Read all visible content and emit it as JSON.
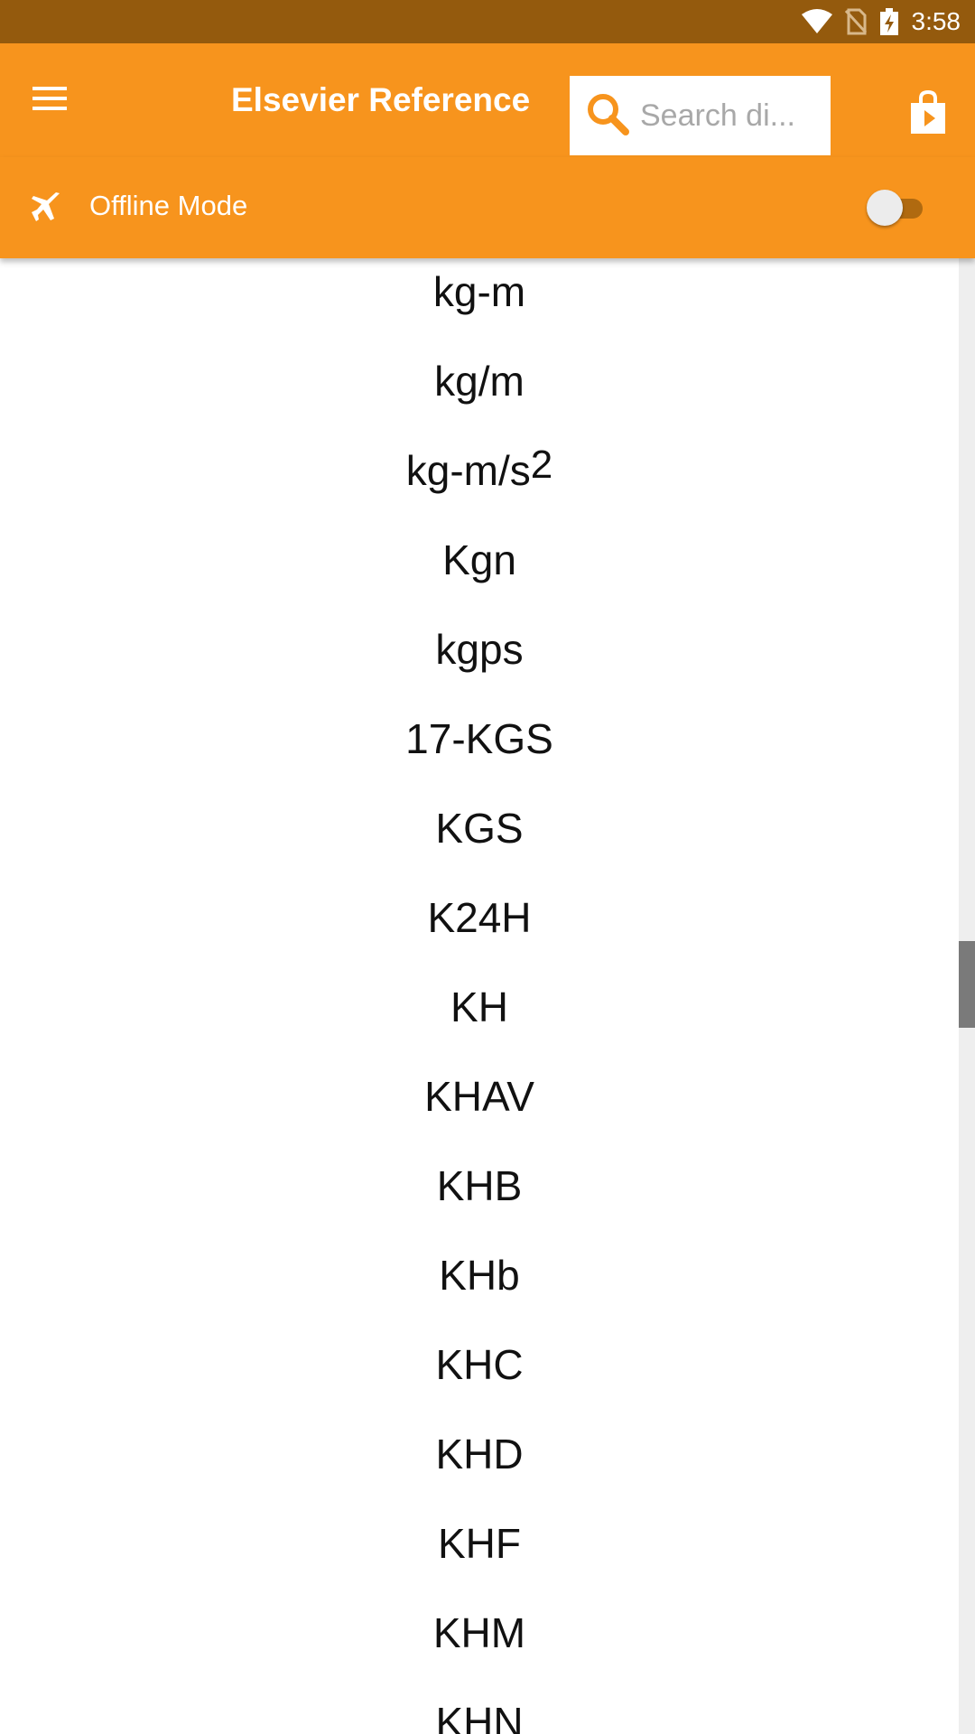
{
  "status_bar": {
    "time": "3:58",
    "icons": [
      "wifi-icon",
      "no-sim-icon",
      "battery-charging-icon"
    ],
    "background": "#945a0d"
  },
  "app_bar": {
    "title": "Elsevier Reference",
    "background": "#f7941d",
    "menu_icon": "hamburger-menu-icon",
    "search": {
      "placeholder": "Search di...",
      "value": "",
      "icon": "search-icon",
      "icon_color": "#f7941d"
    },
    "store_icon": "shopping-bag-play-icon"
  },
  "offline_bar": {
    "icon": "airplane-icon",
    "label": "Offline Mode",
    "toggle_on": false
  },
  "list": {
    "items": [
      {
        "base": "kg-m",
        "sup": ""
      },
      {
        "base": "kg/m",
        "sup": ""
      },
      {
        "base": "kg-m/s",
        "sup": "2"
      },
      {
        "base": "Kgn",
        "sup": ""
      },
      {
        "base": "kgps",
        "sup": ""
      },
      {
        "base": "17-KGS",
        "sup": ""
      },
      {
        "base": "KGS",
        "sup": ""
      },
      {
        "base": "K24H",
        "sup": ""
      },
      {
        "base": "KH",
        "sup": ""
      },
      {
        "base": "KHAV",
        "sup": ""
      },
      {
        "base": "KHB",
        "sup": ""
      },
      {
        "base": "KHb",
        "sup": ""
      },
      {
        "base": "KHC",
        "sup": ""
      },
      {
        "base": "KHD",
        "sup": ""
      },
      {
        "base": "KHF",
        "sup": ""
      },
      {
        "base": "KHM",
        "sup": ""
      },
      {
        "base": "KHN",
        "sup": ""
      }
    ]
  }
}
